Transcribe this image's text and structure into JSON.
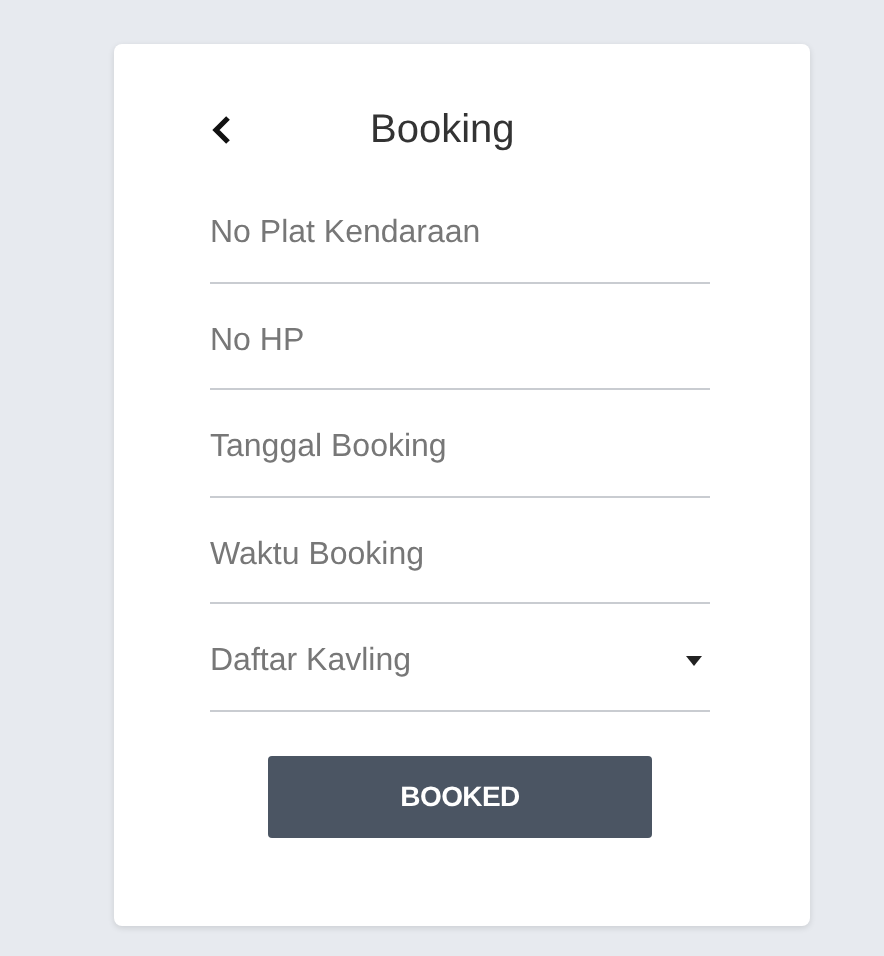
{
  "header": {
    "title": "Booking"
  },
  "fields": [
    {
      "kind": "text",
      "placeholder": "No Plat Kendaraan"
    },
    {
      "kind": "text",
      "placeholder": "No HP"
    },
    {
      "kind": "text",
      "placeholder": "Tanggal Booking"
    },
    {
      "kind": "text",
      "placeholder": "Waktu Booking"
    },
    {
      "kind": "dropdown",
      "placeholder": "Daftar Kavling"
    }
  ],
  "button": {
    "label": "BOOKED"
  }
}
